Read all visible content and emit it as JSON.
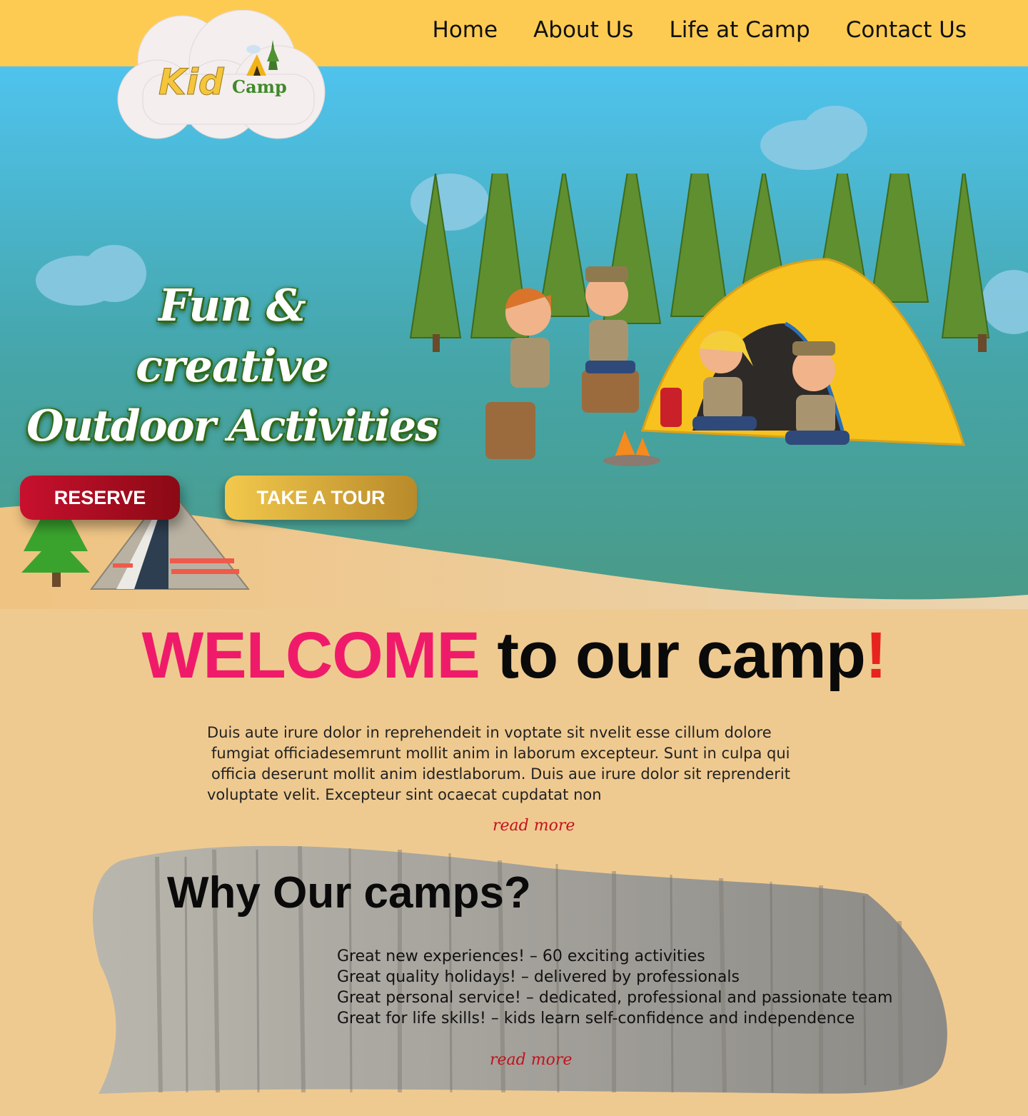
{
  "logo": {
    "word1": "Kid",
    "word2": "Camp"
  },
  "nav": {
    "items": [
      {
        "label": "Home"
      },
      {
        "label": "About Us"
      },
      {
        "label": "Life at Camp"
      },
      {
        "label": "Contact Us"
      }
    ]
  },
  "hero": {
    "title_lines": [
      "Fun &",
      "creative",
      "Outdoor Activities"
    ],
    "reserve_label": "RESERVE",
    "tour_label": "TAKE A TOUR"
  },
  "welcome": {
    "word1": "WELCOME",
    "rest": " to our camp",
    "bang": "!",
    "paragraph_lines": [
      "Duis aute irure dolor in reprehendeit in voptate sit nvelit esse cillum dolore",
      "fumgiat officiadesemrunt mollit anim in laborum excepteur. Sunt in culpa qui",
      "officia deserunt mollit anim idestlaborum. Duis aue irure dolor sit reprenderit",
      "voluptate velit. Excepteur sint ocaecat cupdatat non"
    ],
    "read_more": "read more"
  },
  "why": {
    "title": "Why Our camps?",
    "items": [
      "Great new experiences! – 60 exciting activities",
      "Great quality holidays! – delivered by professionals",
      "Great personal service! – dedicated, professional and passionate team",
      "Great for life skills! – kids learn self-confidence and independence"
    ],
    "read_more": "read more"
  },
  "colors": {
    "header": "#fecb52",
    "sky_top": "#4fc3ee",
    "sky_bottom": "#4a9a86",
    "sand": "#efca90",
    "welcome_pink": "#ef1b6a",
    "reserve_red": "#c8102e",
    "tour_gold": "#f2c94c",
    "read_more_red": "#c2121e"
  }
}
